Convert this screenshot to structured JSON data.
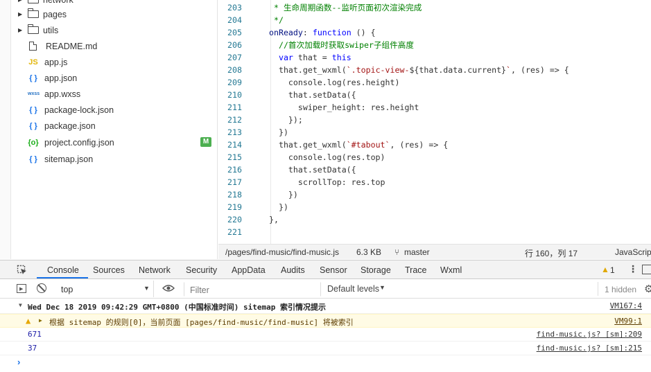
{
  "tree": {
    "items": [
      {
        "type": "folder",
        "name": "network",
        "icon": "folder-icon"
      },
      {
        "type": "folder",
        "name": "pages",
        "icon": "folder-icon"
      },
      {
        "type": "folder",
        "name": "utils",
        "icon": "folder-icon"
      },
      {
        "type": "file",
        "name": "README.md",
        "icon": "file-icon"
      },
      {
        "type": "file",
        "name": "app.js",
        "icon": "js-icon",
        "glyph": "JS"
      },
      {
        "type": "file",
        "name": "app.json",
        "icon": "json-icon",
        "glyph": "{ }"
      },
      {
        "type": "file",
        "name": "app.wxss",
        "icon": "wxss-icon",
        "glyph": "wxss"
      },
      {
        "type": "file",
        "name": "package-lock.json",
        "icon": "json-icon",
        "glyph": "{ }"
      },
      {
        "type": "file",
        "name": "package.json",
        "icon": "json-icon",
        "glyph": "{ }"
      },
      {
        "type": "file",
        "name": "project.config.json",
        "icon": "config-icon",
        "glyph": "{o}",
        "badge": "M"
      },
      {
        "type": "file",
        "name": "sitemap.json",
        "icon": "json-icon",
        "glyph": "{ }"
      }
    ]
  },
  "editor": {
    "lines": [
      {
        "n": "203",
        "code": " * 生命周期函数--监听页面初次渲染完成",
        "cls": "cm",
        "indent": 0
      },
      {
        "n": "204",
        "code": " */",
        "cls": "cm",
        "indent": 0
      },
      {
        "n": "205",
        "code": "onReady: function () {",
        "cls": "mix1",
        "indent": 0
      },
      {
        "n": "206",
        "code": "  //首次加载时获取swiper子组件高度",
        "cls": "cm",
        "indent": 0
      },
      {
        "n": "207",
        "code": "  var that = this",
        "cls": "mix2",
        "indent": 0
      },
      {
        "n": "208",
        "code": "  that.get_wxml(`.topic-view-${that.data.current}`, (res) => {",
        "cls": "mix3",
        "indent": 0
      },
      {
        "n": "209",
        "code": "    console.log(res.height)",
        "cls": "plain",
        "indent": 0
      },
      {
        "n": "210",
        "code": "    that.setData({",
        "cls": "plain",
        "indent": 0
      },
      {
        "n": "211",
        "code": "      swiper_height: res.height",
        "cls": "plain",
        "indent": 0
      },
      {
        "n": "212",
        "code": "    });",
        "cls": "plain",
        "indent": 0
      },
      {
        "n": "213",
        "code": "  })",
        "cls": "plain",
        "indent": 0
      },
      {
        "n": "214",
        "code": "  that.get_wxml(`#tabout`, (res) => {",
        "cls": "mix4",
        "indent": 0
      },
      {
        "n": "215",
        "code": "    console.log(res.top)",
        "cls": "plain",
        "indent": 0
      },
      {
        "n": "216",
        "code": "    that.setData({",
        "cls": "plain",
        "indent": 0
      },
      {
        "n": "217",
        "code": "      scrollTop: res.top",
        "cls": "plain",
        "indent": 0
      },
      {
        "n": "218",
        "code": "    })",
        "cls": "plain",
        "indent": 0
      },
      {
        "n": "219",
        "code": "  })",
        "cls": "plain",
        "indent": 0
      },
      {
        "n": "220",
        "code": "},",
        "cls": "plain",
        "indent": 0
      },
      {
        "n": "221",
        "code": "",
        "cls": "plain",
        "indent": 0
      }
    ]
  },
  "statusbar": {
    "path": "/pages/find-music/find-music.js",
    "size": "6.3 KB",
    "branch": "master",
    "position": "行 160，列 17",
    "language": "JavaScript"
  },
  "devtools": {
    "tabs": [
      "Console",
      "Sources",
      "Network",
      "Security",
      "AppData",
      "Audits",
      "Sensor",
      "Storage",
      "Trace",
      "Wxml"
    ],
    "active_tab": "Console",
    "warning_count": "1",
    "context": "top",
    "filter_placeholder": "Filter",
    "levels": "Default levels",
    "hidden": "1 hidden",
    "messages": [
      {
        "kind": "group",
        "text": "Wed Dec 18 2019 09:42:29 GMT+0800 (中国标准时间) sitemap 索引情况提示",
        "source": "VM167:4"
      },
      {
        "kind": "warn",
        "text": "根据 sitemap 的规则[0]，当前页面 [pages/find-music/find-music] 将被索引",
        "source": "VM99:1"
      },
      {
        "kind": "log",
        "text": "671",
        "source": "find-music.js? [sm]:209"
      },
      {
        "kind": "log",
        "text": "37",
        "source": "find-music.js? [sm]:215"
      }
    ]
  }
}
